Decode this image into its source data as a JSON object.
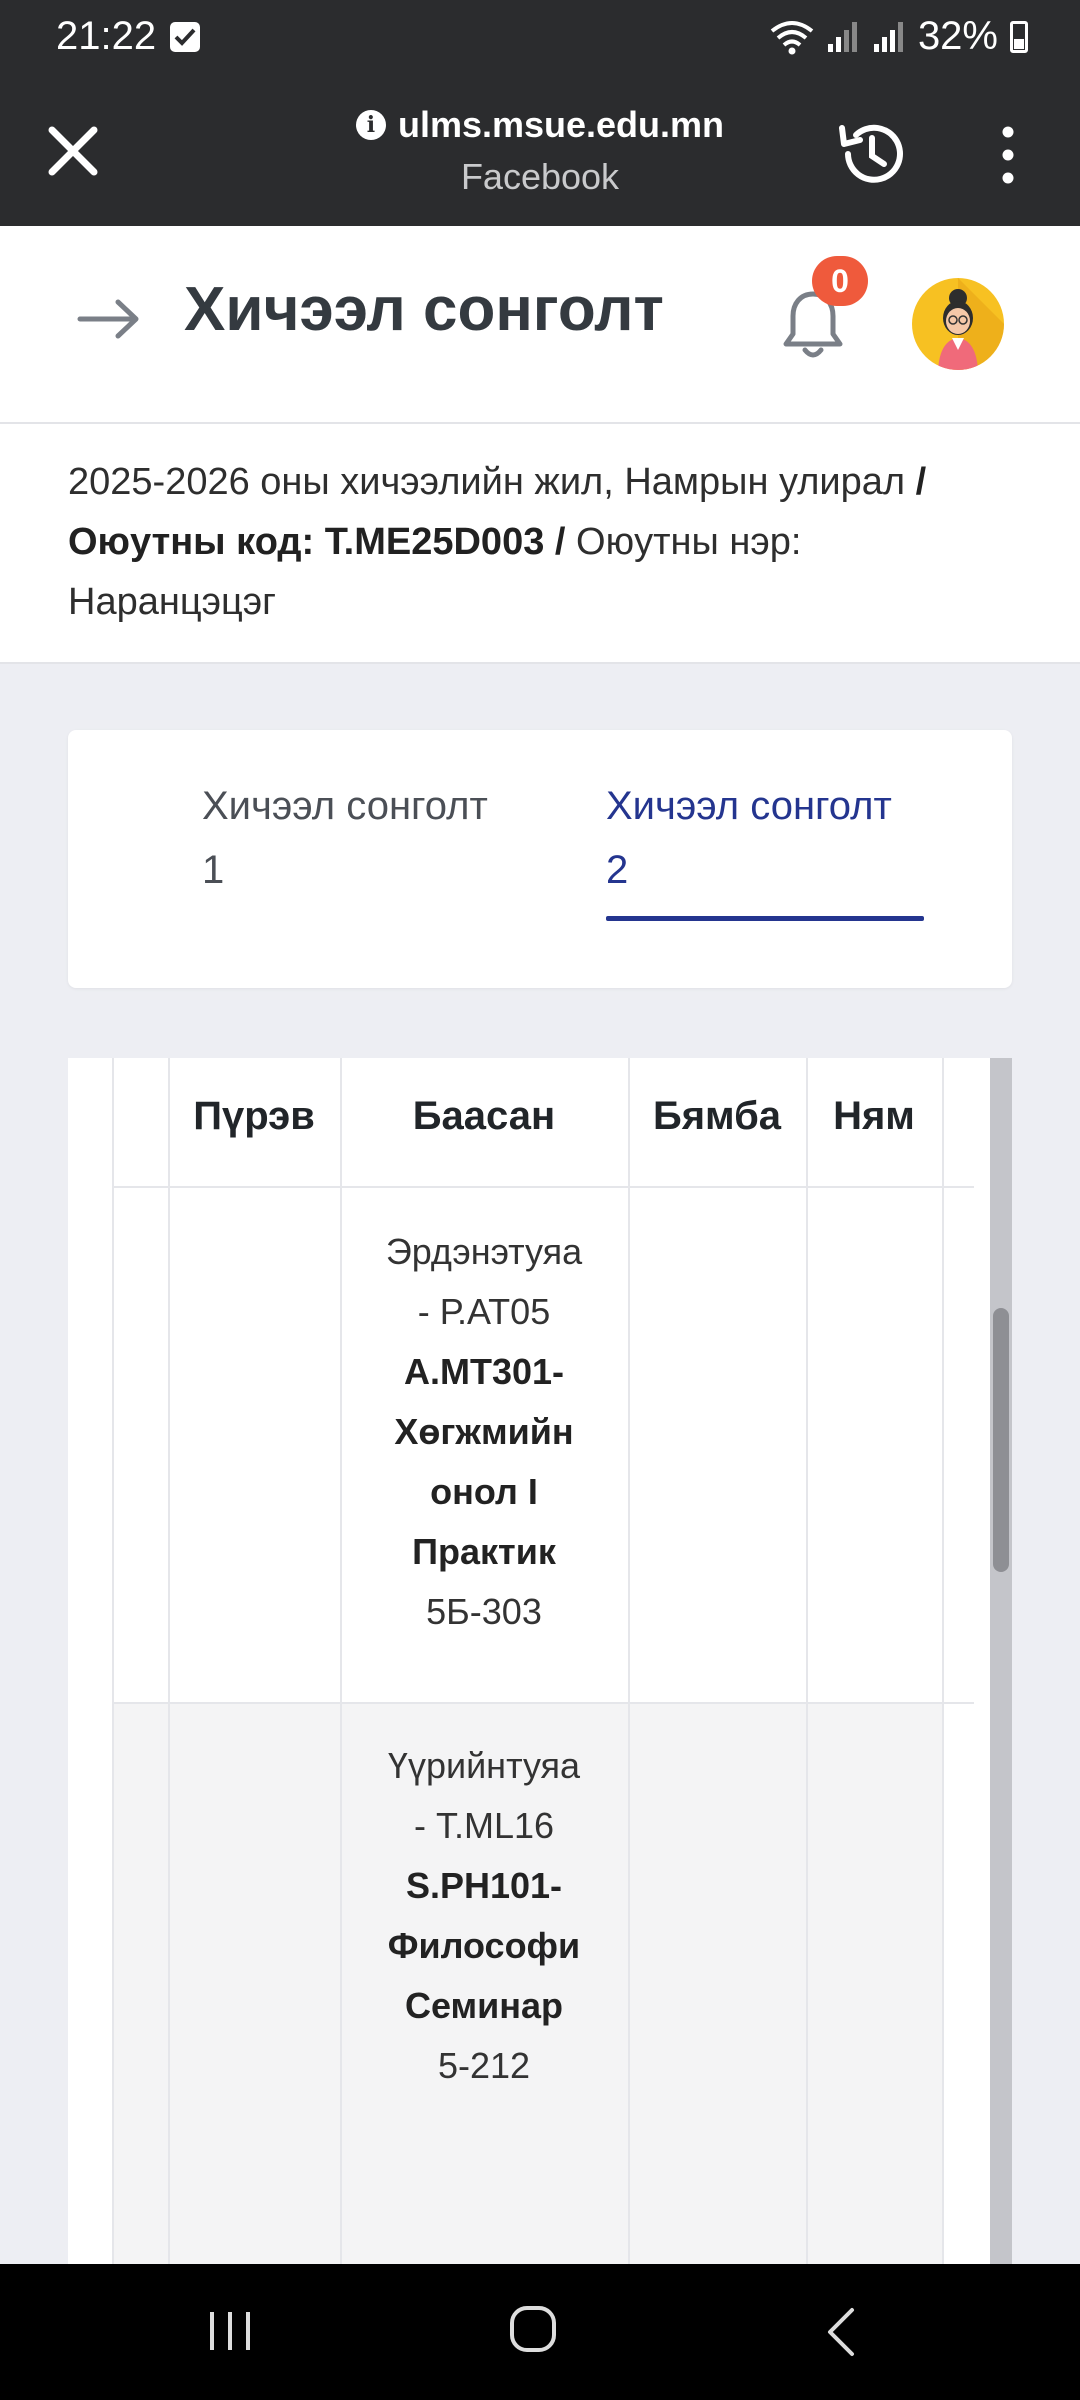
{
  "status_bar": {
    "time": "21:22",
    "battery": "32%"
  },
  "browser": {
    "url": "ulms.msue.edu.mn",
    "subtitle": "Facebook"
  },
  "header": {
    "title": "Хичээл сонголт",
    "notification_count": "0"
  },
  "info": {
    "semester": "2025-2026 оны хичээлийн жил, Намрын улирал",
    "sep1": " / ",
    "student_code_label": "Оюутны код: Т.ME25D003",
    "sep2": " / ",
    "student_name_label": "Оюутны нэр:",
    "student_name": "Наранцэцэг"
  },
  "tabs": [
    {
      "line1": "Хичээл сонголт",
      "line2": "1",
      "active": false
    },
    {
      "line1": "Хичээл сонголт",
      "line2": "2",
      "active": true
    }
  ],
  "schedule": {
    "headers": [
      "Пүрэв",
      "Баасан",
      "Бямба",
      "Ням"
    ],
    "rows": [
      {
        "friday": {
          "teacher": "Эрдэнэтуяа",
          "code": "- Р.АТ05",
          "course_1": "А.МТ301-",
          "course_2": "Хөгжмийн",
          "course_3": "онол I",
          "course_4": "Практик",
          "room": "5Б-303"
        }
      },
      {
        "friday": {
          "teacher": "Үүрийнтуяа",
          "code": "- Т.ML16",
          "course_1": "S.PH101-",
          "course_2": "Философи",
          "course_3": "Семинар",
          "room": "5-212"
        }
      }
    ]
  },
  "colors": {
    "accent": "#24358f",
    "badge": "#ef5a3c",
    "topbar": "#2b2c2e"
  }
}
